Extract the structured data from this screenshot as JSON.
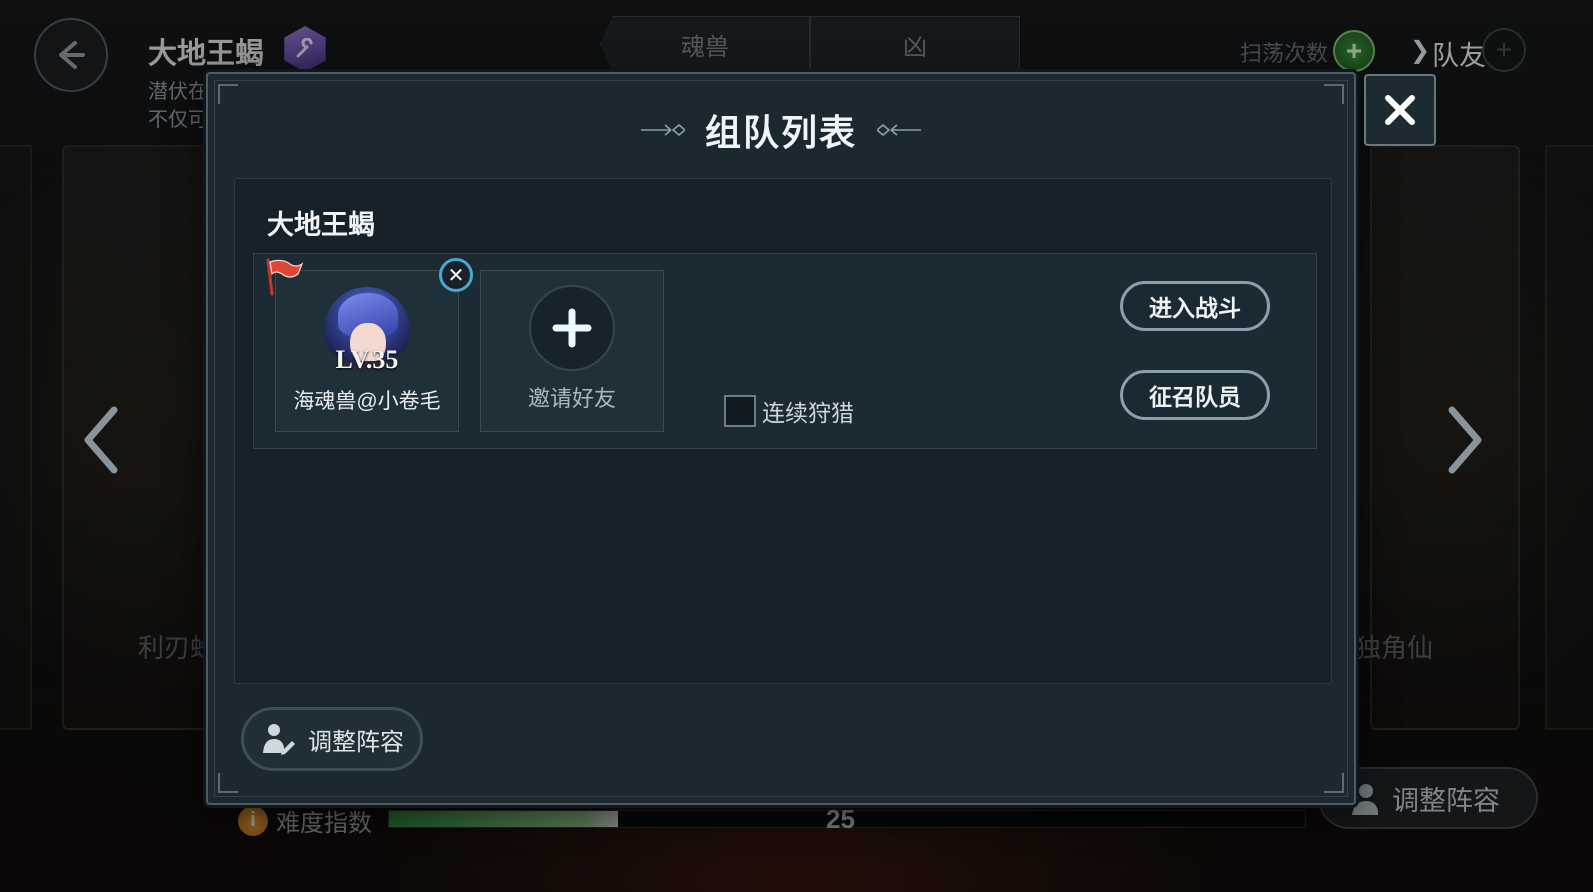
{
  "background": {
    "boss_name": "大地王蝎",
    "boss_desc_line1": "潜伏在",
    "boss_desc_line2": "不仅可",
    "tabs": [
      {
        "label": "魂兽"
      },
      {
        "label": "凶"
      }
    ],
    "sweep_label": "扫荡次数",
    "teammate_label": "队友",
    "left_card_name": "利刃蛛",
    "right_card_name": "独角仙",
    "adjust_lineup_label": "调整阵容",
    "difficulty": {
      "label": "难度指数",
      "value": "25",
      "fill_fraction": 0.25
    }
  },
  "modal": {
    "title": "组队列表",
    "section_title": "大地王蝎",
    "members": [
      {
        "level": "LV.35",
        "name": "海魂兽@小卷毛",
        "is_leader": true
      }
    ],
    "invite_label": "邀请好友",
    "continuous_hunt": {
      "label": "连续狩猎",
      "checked": false
    },
    "enter_battle_label": "进入战斗",
    "recruit_label": "征召队员",
    "adjust_lineup_label": "调整阵容"
  },
  "colors": {
    "modal_bg": "#1c2830",
    "accent_blue": "#4aa7d8",
    "green_plus": "#3d9a3f",
    "difficulty_fill": "#2f8a3a",
    "leader_flag": "#c0392b"
  },
  "icons": {
    "back": "arrow-left-icon",
    "close": "close-icon",
    "add_friend": "plus-icon",
    "leader": "flag-icon",
    "remove_member": "close-circle-icon",
    "adjust_lineup": "user-edit-icon",
    "difficulty_info": "info-icon",
    "prev": "chevron-left-icon",
    "next": "chevron-right-icon"
  }
}
